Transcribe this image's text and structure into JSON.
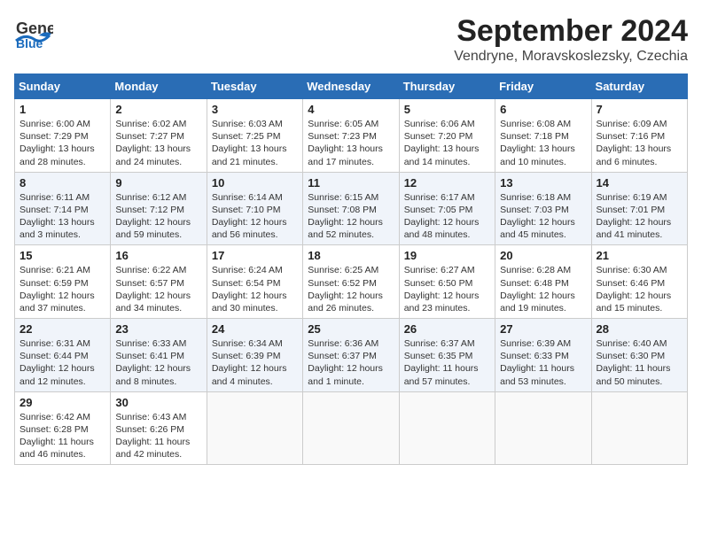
{
  "header": {
    "logo_general": "General",
    "logo_blue": "Blue",
    "month_title": "September 2024",
    "location": "Vendryne, Moravskoslezsky, Czechia"
  },
  "days_of_week": [
    "Sunday",
    "Monday",
    "Tuesday",
    "Wednesday",
    "Thursday",
    "Friday",
    "Saturday"
  ],
  "weeks": [
    [
      {
        "day": "1",
        "sunrise": "Sunrise: 6:00 AM",
        "sunset": "Sunset: 7:29 PM",
        "daylight": "Daylight: 13 hours and 28 minutes."
      },
      {
        "day": "2",
        "sunrise": "Sunrise: 6:02 AM",
        "sunset": "Sunset: 7:27 PM",
        "daylight": "Daylight: 13 hours and 24 minutes."
      },
      {
        "day": "3",
        "sunrise": "Sunrise: 6:03 AM",
        "sunset": "Sunset: 7:25 PM",
        "daylight": "Daylight: 13 hours and 21 minutes."
      },
      {
        "day": "4",
        "sunrise": "Sunrise: 6:05 AM",
        "sunset": "Sunset: 7:23 PM",
        "daylight": "Daylight: 13 hours and 17 minutes."
      },
      {
        "day": "5",
        "sunrise": "Sunrise: 6:06 AM",
        "sunset": "Sunset: 7:20 PM",
        "daylight": "Daylight: 13 hours and 14 minutes."
      },
      {
        "day": "6",
        "sunrise": "Sunrise: 6:08 AM",
        "sunset": "Sunset: 7:18 PM",
        "daylight": "Daylight: 13 hours and 10 minutes."
      },
      {
        "day": "7",
        "sunrise": "Sunrise: 6:09 AM",
        "sunset": "Sunset: 7:16 PM",
        "daylight": "Daylight: 13 hours and 6 minutes."
      }
    ],
    [
      {
        "day": "8",
        "sunrise": "Sunrise: 6:11 AM",
        "sunset": "Sunset: 7:14 PM",
        "daylight": "Daylight: 13 hours and 3 minutes."
      },
      {
        "day": "9",
        "sunrise": "Sunrise: 6:12 AM",
        "sunset": "Sunset: 7:12 PM",
        "daylight": "Daylight: 12 hours and 59 minutes."
      },
      {
        "day": "10",
        "sunrise": "Sunrise: 6:14 AM",
        "sunset": "Sunset: 7:10 PM",
        "daylight": "Daylight: 12 hours and 56 minutes."
      },
      {
        "day": "11",
        "sunrise": "Sunrise: 6:15 AM",
        "sunset": "Sunset: 7:08 PM",
        "daylight": "Daylight: 12 hours and 52 minutes."
      },
      {
        "day": "12",
        "sunrise": "Sunrise: 6:17 AM",
        "sunset": "Sunset: 7:05 PM",
        "daylight": "Daylight: 12 hours and 48 minutes."
      },
      {
        "day": "13",
        "sunrise": "Sunrise: 6:18 AM",
        "sunset": "Sunset: 7:03 PM",
        "daylight": "Daylight: 12 hours and 45 minutes."
      },
      {
        "day": "14",
        "sunrise": "Sunrise: 6:19 AM",
        "sunset": "Sunset: 7:01 PM",
        "daylight": "Daylight: 12 hours and 41 minutes."
      }
    ],
    [
      {
        "day": "15",
        "sunrise": "Sunrise: 6:21 AM",
        "sunset": "Sunset: 6:59 PM",
        "daylight": "Daylight: 12 hours and 37 minutes."
      },
      {
        "day": "16",
        "sunrise": "Sunrise: 6:22 AM",
        "sunset": "Sunset: 6:57 PM",
        "daylight": "Daylight: 12 hours and 34 minutes."
      },
      {
        "day": "17",
        "sunrise": "Sunrise: 6:24 AM",
        "sunset": "Sunset: 6:54 PM",
        "daylight": "Daylight: 12 hours and 30 minutes."
      },
      {
        "day": "18",
        "sunrise": "Sunrise: 6:25 AM",
        "sunset": "Sunset: 6:52 PM",
        "daylight": "Daylight: 12 hours and 26 minutes."
      },
      {
        "day": "19",
        "sunrise": "Sunrise: 6:27 AM",
        "sunset": "Sunset: 6:50 PM",
        "daylight": "Daylight: 12 hours and 23 minutes."
      },
      {
        "day": "20",
        "sunrise": "Sunrise: 6:28 AM",
        "sunset": "Sunset: 6:48 PM",
        "daylight": "Daylight: 12 hours and 19 minutes."
      },
      {
        "day": "21",
        "sunrise": "Sunrise: 6:30 AM",
        "sunset": "Sunset: 6:46 PM",
        "daylight": "Daylight: 12 hours and 15 minutes."
      }
    ],
    [
      {
        "day": "22",
        "sunrise": "Sunrise: 6:31 AM",
        "sunset": "Sunset: 6:44 PM",
        "daylight": "Daylight: 12 hours and 12 minutes."
      },
      {
        "day": "23",
        "sunrise": "Sunrise: 6:33 AM",
        "sunset": "Sunset: 6:41 PM",
        "daylight": "Daylight: 12 hours and 8 minutes."
      },
      {
        "day": "24",
        "sunrise": "Sunrise: 6:34 AM",
        "sunset": "Sunset: 6:39 PM",
        "daylight": "Daylight: 12 hours and 4 minutes."
      },
      {
        "day": "25",
        "sunrise": "Sunrise: 6:36 AM",
        "sunset": "Sunset: 6:37 PM",
        "daylight": "Daylight: 12 hours and 1 minute."
      },
      {
        "day": "26",
        "sunrise": "Sunrise: 6:37 AM",
        "sunset": "Sunset: 6:35 PM",
        "daylight": "Daylight: 11 hours and 57 minutes."
      },
      {
        "day": "27",
        "sunrise": "Sunrise: 6:39 AM",
        "sunset": "Sunset: 6:33 PM",
        "daylight": "Daylight: 11 hours and 53 minutes."
      },
      {
        "day": "28",
        "sunrise": "Sunrise: 6:40 AM",
        "sunset": "Sunset: 6:30 PM",
        "daylight": "Daylight: 11 hours and 50 minutes."
      }
    ],
    [
      {
        "day": "29",
        "sunrise": "Sunrise: 6:42 AM",
        "sunset": "Sunset: 6:28 PM",
        "daylight": "Daylight: 11 hours and 46 minutes."
      },
      {
        "day": "30",
        "sunrise": "Sunrise: 6:43 AM",
        "sunset": "Sunset: 6:26 PM",
        "daylight": "Daylight: 11 hours and 42 minutes."
      },
      null,
      null,
      null,
      null,
      null
    ]
  ]
}
